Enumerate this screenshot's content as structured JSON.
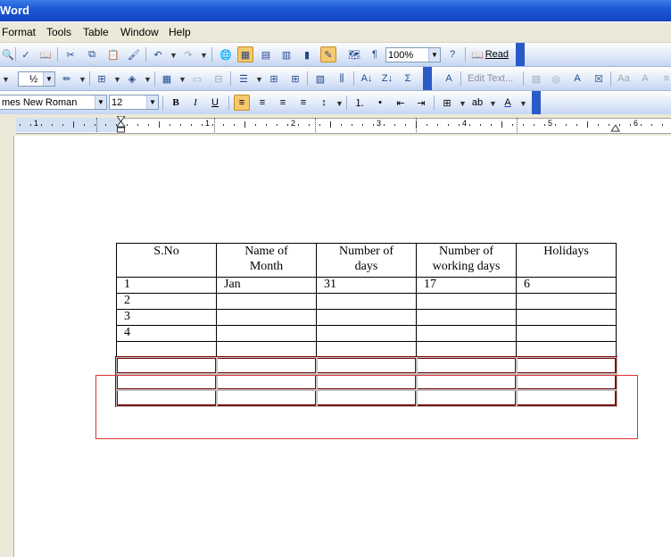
{
  "window": {
    "title": "Word"
  },
  "menu": [
    "Format",
    "Tools",
    "Table",
    "Window",
    "Help"
  ],
  "toolbar1": {
    "zoom": "100%",
    "read_label": "Read"
  },
  "toolbar2": {
    "line_weight": "½",
    "edit_text": "Edit Text..."
  },
  "toolbar3": {
    "font_name": "mes New Roman",
    "font_size": "12"
  },
  "ruler": {
    "numbers": [
      "1",
      "1",
      "2",
      "3",
      "4",
      "5",
      "6"
    ]
  },
  "table": {
    "headers": [
      "S.No",
      "Name of Month",
      "Number of days",
      "Number of working days",
      "Holidays"
    ],
    "header_lines": [
      [
        "S.No"
      ],
      [
        "Name of",
        "Month"
      ],
      [
        "Number of",
        "days"
      ],
      [
        "Number of",
        "working days"
      ],
      [
        "Holidays"
      ]
    ],
    "rows": [
      [
        "1",
        "Jan",
        "31",
        "17",
        "6"
      ],
      [
        "2",
        "",
        "",
        "",
        ""
      ],
      [
        "3",
        "",
        "",
        "",
        ""
      ],
      [
        "4",
        "",
        "",
        "",
        ""
      ],
      [
        "",
        "",
        "",
        "",
        ""
      ]
    ],
    "selected_rows": 3
  }
}
